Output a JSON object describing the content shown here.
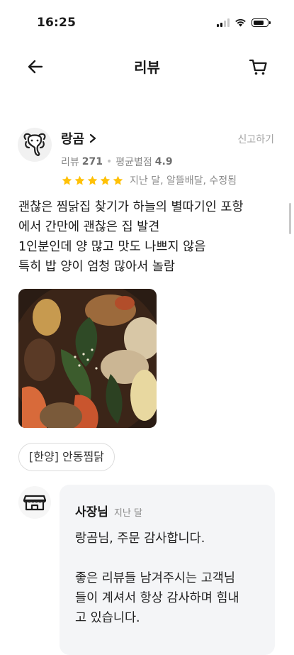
{
  "status_bar": {
    "time": "16:25",
    "signal_bars": 2,
    "battery_level": 0.75
  },
  "header": {
    "title": "리뷰",
    "back_icon": "arrow-left-icon",
    "cart_icon": "cart-icon"
  },
  "review": {
    "reviewer_name": "랑곰",
    "report_label": "신고하기",
    "review_count_label": "리뷰",
    "review_count": "271",
    "avg_rating_label": "평균별점",
    "avg_rating": "4.9",
    "stars": 5,
    "meta": "지난 달, 알뜰배달, 수정됨",
    "text_lines": [
      "괜찮은 찜닭집 찾기가 하늘의 별따기인 포항",
      "에서 간만에 괜찮은 집 발견",
      "1인분인데 양 많고 맛도 나쁘지 않음",
      "특히 밥 양이 엄청 많아서 놀람"
    ],
    "menu_tag": "[한양] 안동찜닭"
  },
  "owner_reply": {
    "name": "사장님",
    "time": "지난 달",
    "text_lines": [
      "랑곰님,  주문 감사합니다.",
      "",
      "좋은 리뷰들 남겨주시는 고객님",
      "들이 계셔서 항상 감사하며 힘내",
      "고 있습니다."
    ]
  },
  "colors": {
    "star": "#ffc107",
    "muted": "#8a8a8a",
    "bubble": "#f4f5f7"
  }
}
